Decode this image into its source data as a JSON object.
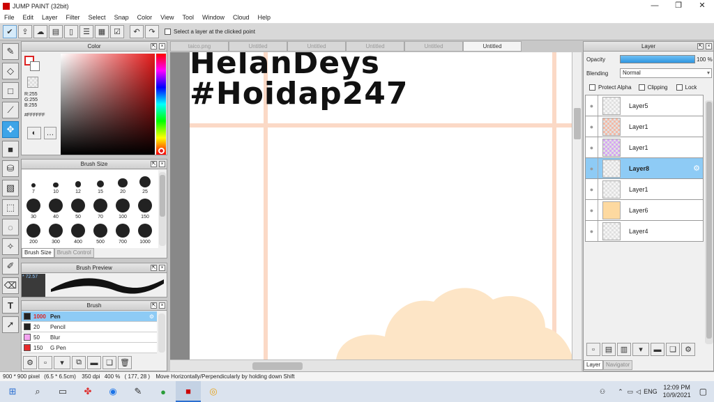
{
  "window": {
    "title": "JUMP PAINT (32bit)",
    "minimize": "—",
    "maximize": "❐",
    "close": "✕"
  },
  "menu": [
    "File",
    "Edit",
    "Layer",
    "Filter",
    "Select",
    "Snap",
    "Color",
    "View",
    "Tool",
    "Window",
    "Cloud",
    "Help"
  ],
  "toolbar": {
    "select_layer_label": "Select a layer at the clicked point"
  },
  "color_panel": {
    "title": "Color",
    "r": "R:255",
    "g": "G:255",
    "b": "B:255",
    "hex": "#FFFFFF",
    "foreground": "#ffffff",
    "hue_marker_color": "#ff0000"
  },
  "brush_size_panel": {
    "title": "Brush Size",
    "sizes": [
      "7",
      "10",
      "12",
      "15",
      "20",
      "25",
      "30",
      "40",
      "50",
      "70",
      "100",
      "150",
      "200",
      "300",
      "400",
      "500",
      "700",
      "1000"
    ],
    "tabs": [
      "Brush Size",
      "Brush Control"
    ]
  },
  "brush_preview_panel": {
    "title": "Brush Preview",
    "size_label": "* 72.57"
  },
  "brush_panel": {
    "title": "Brush",
    "items": [
      {
        "size": "1000",
        "name": "Pen",
        "color": "#222222",
        "selected": true
      },
      {
        "size": "20",
        "name": "Pencil",
        "color": "#222222",
        "selected": false
      },
      {
        "size": "50",
        "name": "Blur",
        "color": "#f4a3f0",
        "selected": false
      },
      {
        "size": "150",
        "name": "G Pen",
        "color": "#e82b2b",
        "selected": false
      }
    ]
  },
  "tabs": [
    {
      "label": "taico.png",
      "active": false
    },
    {
      "label": "Untitled",
      "active": false
    },
    {
      "label": "Untitled",
      "active": false
    },
    {
      "label": "Untitled",
      "active": false
    },
    {
      "label": "Untitled",
      "active": false
    },
    {
      "label": "Untitled",
      "active": true
    }
  ],
  "canvas": {
    "line1": "HelanDeys",
    "line2": "#Hoidap247",
    "grid_color": "#fbd9c6",
    "cloud_color": "#fde5c6"
  },
  "layer_panel": {
    "title": "Layer",
    "opacity_label": "Opacity",
    "opacity_value": "100 %",
    "blending_label": "Blending",
    "blending_value": "Normal",
    "protect_alpha": "Protect Alpha",
    "clipping": "Clipping",
    "lock": "Lock",
    "layers": [
      {
        "name": "Layer5",
        "selected": false,
        "thumb": ""
      },
      {
        "name": "Layer1",
        "selected": false,
        "thumb": "#f3b9a6"
      },
      {
        "name": "Layer1",
        "selected": false,
        "thumb": "#d6a7f2"
      },
      {
        "name": "Layer8",
        "selected": true,
        "thumb": ""
      },
      {
        "name": "Layer1",
        "selected": false,
        "thumb": ""
      },
      {
        "name": "Layer6",
        "selected": false,
        "thumb": "#fdd9a0"
      },
      {
        "name": "Layer4",
        "selected": false,
        "thumb": ""
      }
    ],
    "bottom_tabs": [
      "Layer",
      "Navigator"
    ]
  },
  "status": {
    "size": "900 * 900 pixel",
    "physical": "(6.5 * 6.5cm)",
    "dpi": "350 dpi",
    "zoom": "400 %",
    "coords": "( 177, 28 )",
    "hint": "Move Horizontally/Perpendicularly by holding down Shift"
  },
  "taskbar": {
    "tray_lang": "ENG",
    "time": "12:09 PM",
    "date": "10/9/2021"
  }
}
